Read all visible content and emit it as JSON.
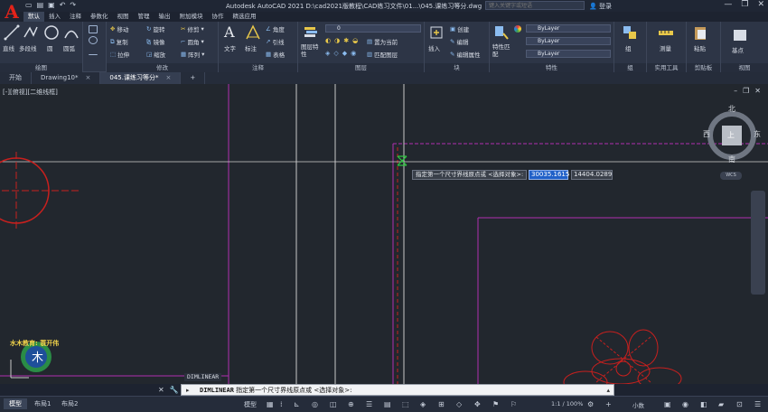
{
  "titlebar": {
    "logo": "A",
    "title": "Autodesk AutoCAD 2021    D:\\cad2021版教程\\CAD练习文件\\01...\\045.课练习等分.dwg",
    "search_placeholder": "键入关键字或短语",
    "login": "登录",
    "qat_icons": [
      "new-icon",
      "open-icon",
      "save-icon",
      "undo-icon",
      "redo-icon"
    ]
  },
  "ribbon_tabs": [
    "默认",
    "插入",
    "注释",
    "参数化",
    "视图",
    "管理",
    "输出",
    "附加模块",
    "协作",
    "精选应用"
  ],
  "ribbon": {
    "draw": {
      "label": "绘图",
      "line": "直线",
      "polyline": "多段线",
      "circle": "圆",
      "arc": "圆弧"
    },
    "modify": {
      "label": "修改",
      "move": "移动",
      "rotate": "旋转",
      "trim": "修剪",
      "copy": "复制",
      "mirror": "镜像",
      "fillet": "圆角",
      "stretch": "拉伸",
      "scale": "缩放",
      "array": "阵列"
    },
    "annotation": {
      "label": "注释",
      "text": "文字",
      "dimension": "标注",
      "leader": "引线",
      "table": "表格",
      "angle": "角度"
    },
    "layers": {
      "label": "图层",
      "layer_props": "图层特性",
      "current_layer": "0",
      "set_current": "置为当前",
      "match_layer": "匹配图层"
    },
    "block": {
      "label": "块",
      "insert": "插入",
      "create": "创建",
      "edit": "编辑",
      "edit_attr": "编辑属性"
    },
    "properties": {
      "label": "特性",
      "match": "特性匹配",
      "color": "ByLayer",
      "linetype": "ByLayer",
      "lineweight": "ByLayer"
    },
    "groups": {
      "label": "组",
      "group": "组"
    },
    "utilities": {
      "label": "实用工具",
      "measure": "测量"
    },
    "clipboard": {
      "label": "剪贴板",
      "paste": "粘贴"
    },
    "view": {
      "label": "视图",
      "base": "基点"
    }
  },
  "file_tabs": [
    {
      "label": "开始",
      "active": false
    },
    {
      "label": "Drawing10*",
      "active": false
    },
    {
      "label": "045.课练习等分*",
      "active": true
    }
  ],
  "viewport": {
    "label": "[-][俯视][二维线框]",
    "viewcube": {
      "north": "北",
      "south": "南",
      "east": "东",
      "west": "西",
      "face": "上"
    },
    "wcs": "WCS"
  },
  "dyn_input": {
    "prompt": "指定第一个尺寸界线原点或 <选择对象>:",
    "x_value": "30035.1615",
    "y_value": "14404.0289"
  },
  "watermark": "水木教育: 蓑开伟",
  "cmd_history": "DIMLINEAR",
  "command_line": {
    "command": "DIMLINEAR",
    "text": "指定第一个尺寸界线原点或 <选择对象>:"
  },
  "status": {
    "layout_tabs": [
      {
        "label": "模型",
        "active": true
      },
      {
        "label": "布局1",
        "active": false
      },
      {
        "label": "布局2",
        "active": false
      }
    ],
    "model": "模型",
    "scale": "1:1 / 100%",
    "units": "小数"
  },
  "colors": {
    "magenta": "#b02fb0",
    "red": "#c8201e",
    "crosshair": "#d0d0d0",
    "accent_blue": "#2060c8"
  }
}
